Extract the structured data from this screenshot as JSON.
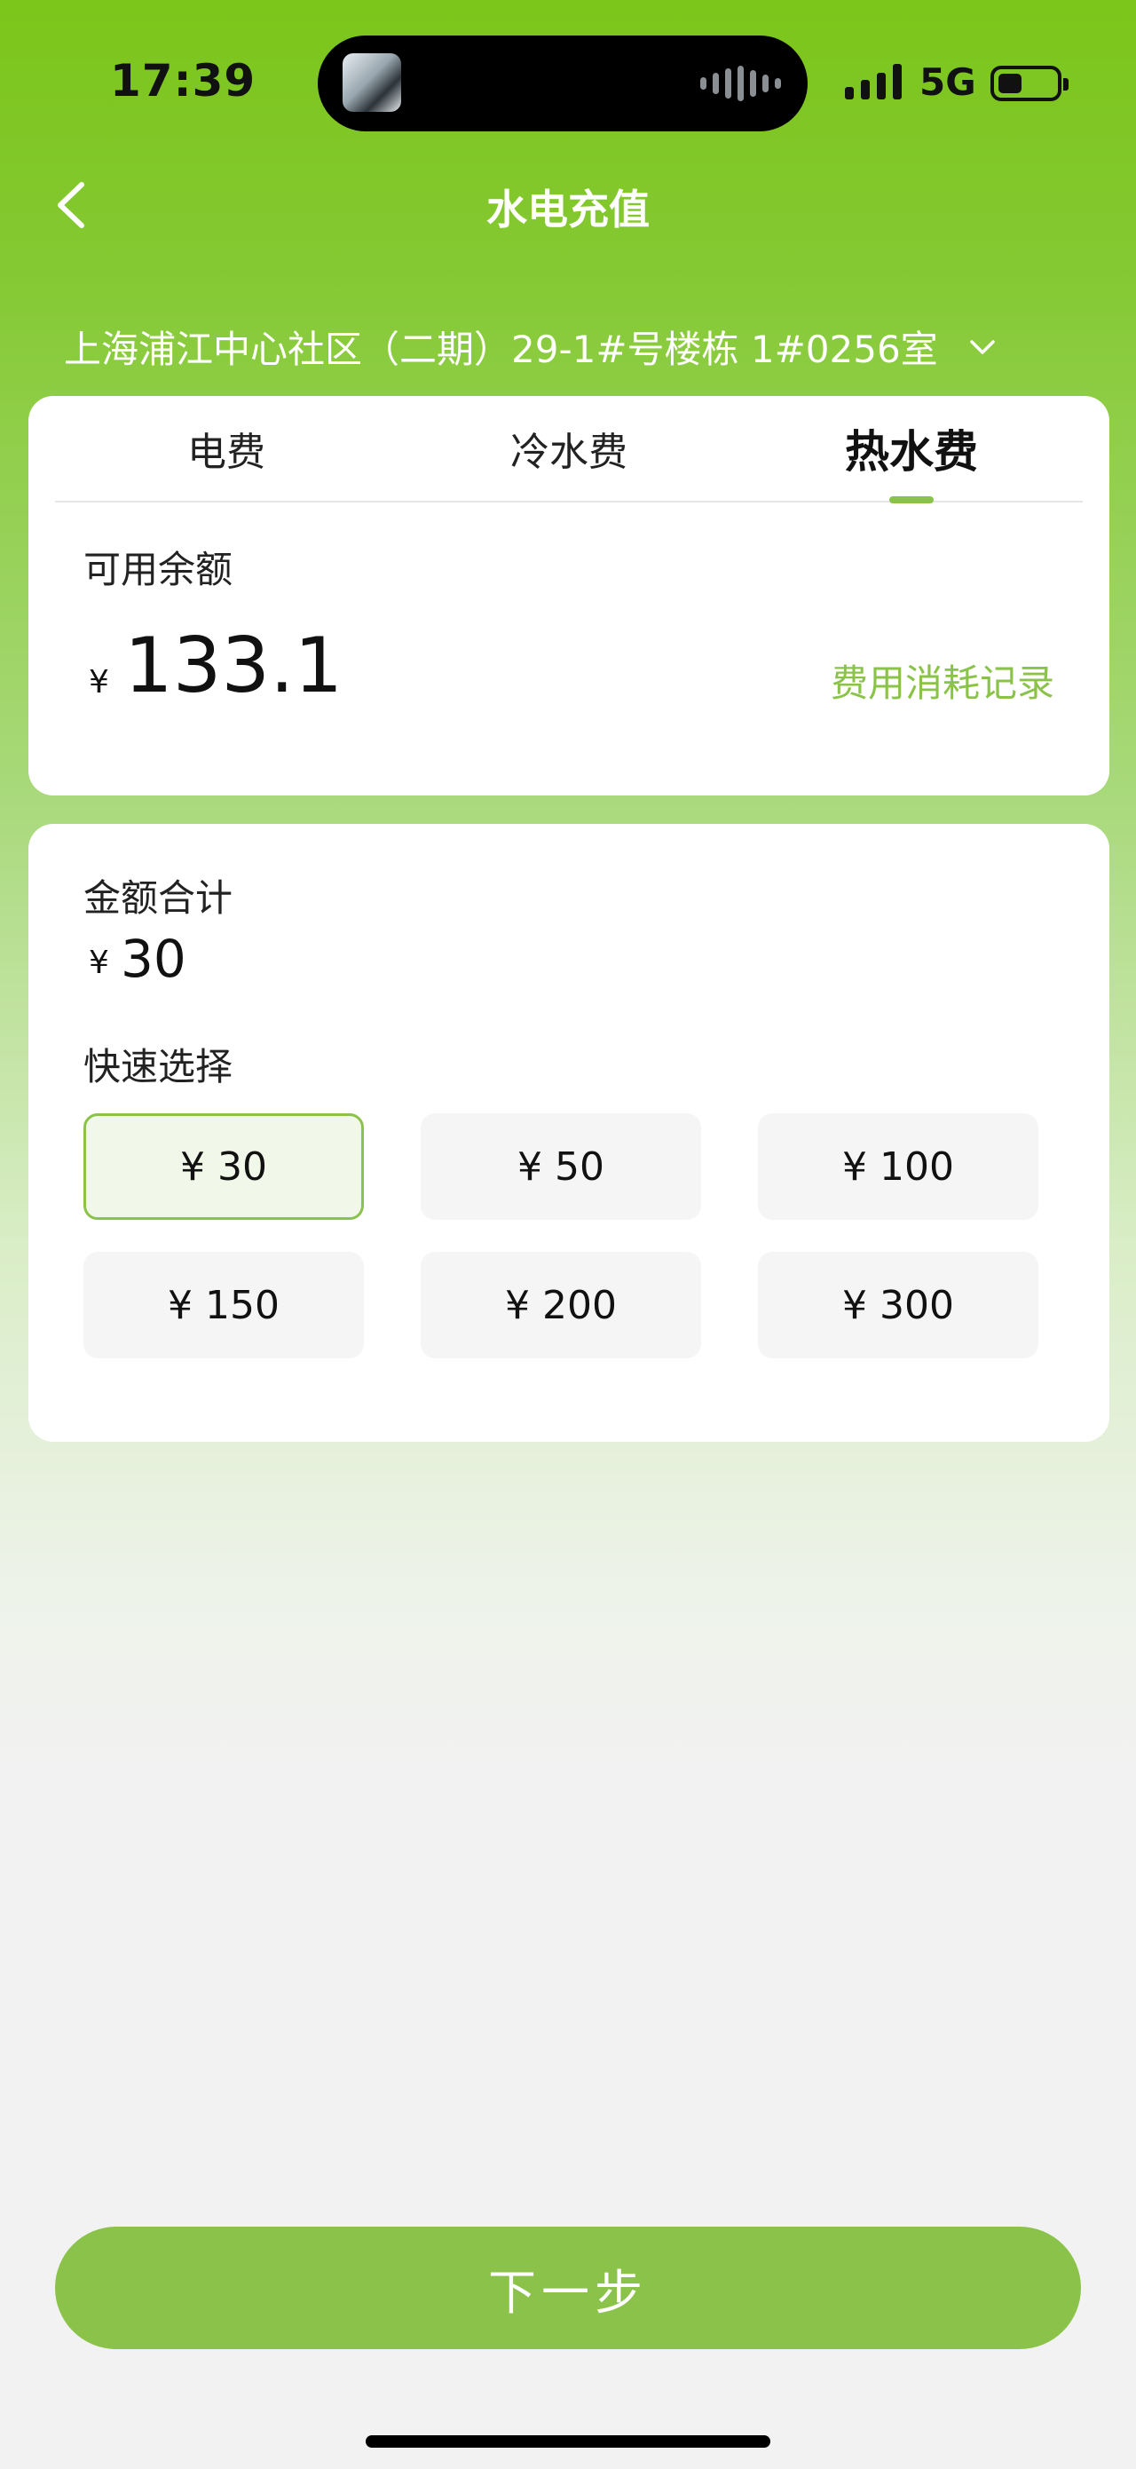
{
  "status": {
    "time": "17:39",
    "network": "5G"
  },
  "nav": {
    "title": "水电充值"
  },
  "address": "上海浦江中心社区（二期）29-1#号楼栋 1#0256室",
  "tabs": [
    {
      "label": "电费",
      "active": false
    },
    {
      "label": "冷水费",
      "active": false
    },
    {
      "label": "热水费",
      "active": true
    }
  ],
  "balance": {
    "label": "可用余额",
    "currency": "¥",
    "value": "133.1",
    "record_link": "费用消耗记录"
  },
  "total": {
    "label": "金额合计",
    "currency": "¥",
    "value": "30"
  },
  "quick": {
    "label": "快速选择",
    "options": [
      "¥ 30",
      "¥ 50",
      "¥ 100",
      "¥ 150",
      "¥ 200",
      "¥ 300"
    ],
    "selected_index": 0
  },
  "next_button": "下一步",
  "colors": {
    "accent": "#8bc34a",
    "header_green": "#7cc51a"
  }
}
